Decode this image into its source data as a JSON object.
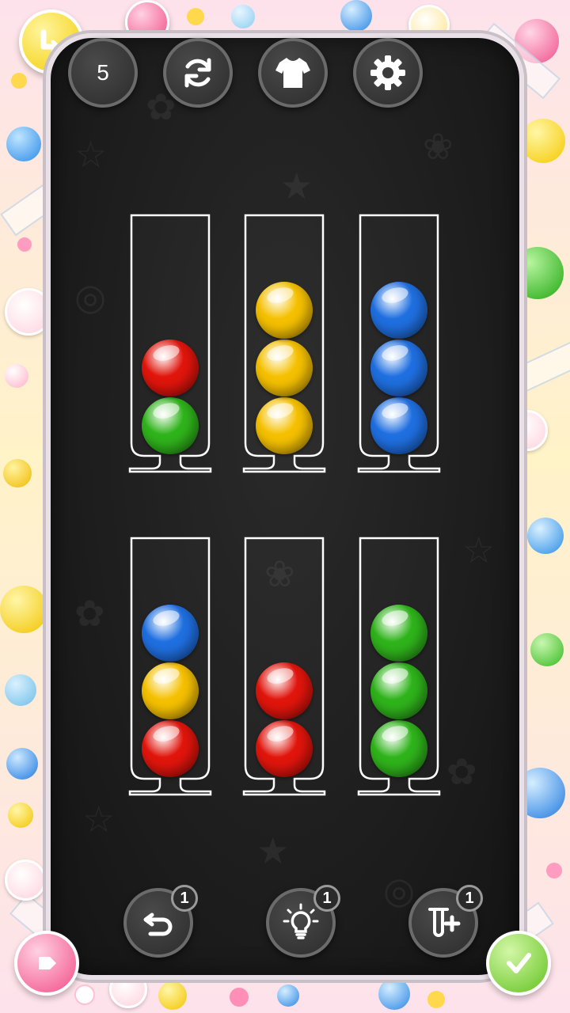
{
  "hud": {
    "level": "5",
    "restart_icon": "restart-icon",
    "skin_icon": "tshirt-icon",
    "settings_icon": "gear-icon"
  },
  "bottom_bar": {
    "undo_count": "1",
    "hint_count": "1",
    "add_tube_count": "1"
  },
  "colors": {
    "red": "#e0150c",
    "green": "#2fb31b",
    "yellow": "#f5c000",
    "blue": "#1f6fe0",
    "board_bg": "#1b1b1b",
    "frame_pink": "#fde2ec"
  },
  "tubes": [
    {
      "balls_bottom_to_top": [
        "green",
        "red"
      ]
    },
    {
      "balls_bottom_to_top": [
        "yellow",
        "yellow",
        "yellow"
      ]
    },
    {
      "balls_bottom_to_top": [
        "blue",
        "blue",
        "blue"
      ]
    },
    {
      "balls_bottom_to_top": [
        "red",
        "yellow",
        "blue"
      ]
    },
    {
      "balls_bottom_to_top": [
        "red",
        "red"
      ]
    },
    {
      "balls_bottom_to_top": [
        "green",
        "green",
        "green"
      ]
    }
  ]
}
